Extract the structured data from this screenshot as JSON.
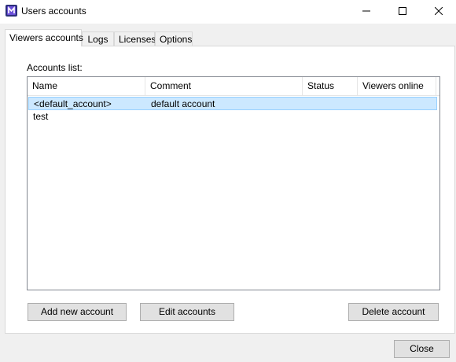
{
  "window": {
    "title": "Users accounts",
    "icon": "app-logo-icon",
    "controls": {
      "minimize": "minimize-icon",
      "maximize": "maximize-icon",
      "close": "close-icon"
    }
  },
  "tabs": [
    {
      "label": "Viewers accounts",
      "active": true
    },
    {
      "label": "Logs",
      "active": false
    },
    {
      "label": "Licenses",
      "active": false
    },
    {
      "label": "Options",
      "active": false
    }
  ],
  "panel": {
    "accounts_label": "Accounts list:",
    "columns": [
      "Name",
      "Comment",
      "Status",
      "Viewers online"
    ],
    "rows": [
      {
        "name": "<default_account>",
        "comment": "default account",
        "status": "",
        "viewers_online": "",
        "selected": true
      },
      {
        "name": "test",
        "comment": "",
        "status": "",
        "viewers_online": "",
        "selected": false
      }
    ],
    "buttons": {
      "add": "Add new account",
      "edit": "Edit accounts",
      "delete": "Delete account"
    }
  },
  "footer": {
    "close": "Close"
  },
  "colors": {
    "selection_bg": "#cce8ff",
    "selection_border": "#99d1ff",
    "button_bg": "#e1e1e1",
    "button_border": "#adadad",
    "window_bg": "#f0f0f0"
  }
}
